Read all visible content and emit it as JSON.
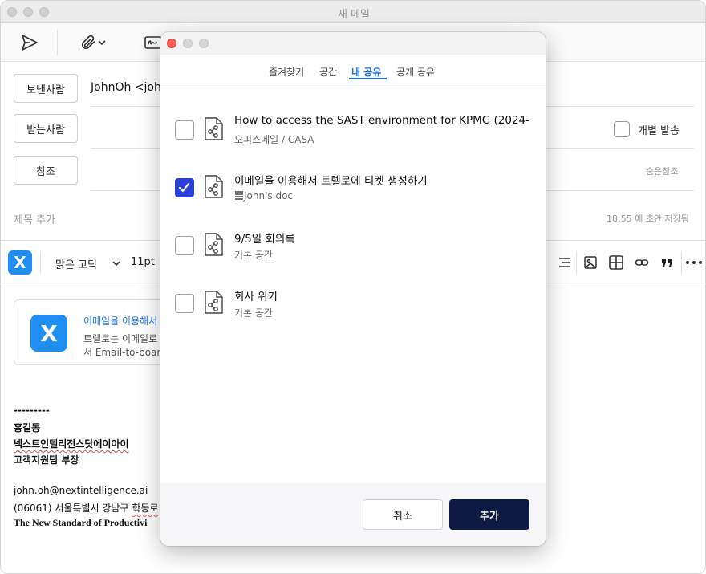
{
  "window": {
    "title": "새 메일"
  },
  "compose": {
    "from_label": "보낸사람",
    "from_value": "JohnOh <john",
    "to_label": "받는사람",
    "cc_label": "참조",
    "individual_send": "개별 발송",
    "bcc_link": "숨은참조",
    "subject_placeholder": "제목 추가",
    "saved_status": "18:55 에 초안 저장됨"
  },
  "format_toolbar": {
    "font": "맑은 고딕",
    "size": "11pt"
  },
  "card": {
    "title": "이메일을 이용해서",
    "desc_line1": "트렐로는 이메일로",
    "desc_line2": "서 Email-to-board"
  },
  "signature": {
    "dashes": "---------",
    "name": "홍길동",
    "company": "넥스트인텔리전스닷에이아이",
    "position": "고객지원팀 부장",
    "email": "john.oh@nextintelligence.ai",
    "address_prefix": "(06061) 서울특별시 강남구 ",
    "address_tail": "학동로",
    "tagline": "The New Standard of Productivi"
  },
  "dialog": {
    "tabs": [
      {
        "label": "즐겨찾기"
      },
      {
        "label": "공간"
      },
      {
        "label": "내 공유"
      },
      {
        "label": "공개 공유"
      }
    ],
    "active_tab": "내 공유",
    "items": [
      {
        "title": "How to access the SAST environment for KPMG (2024-",
        "subtitle": "오피스메일 / CASA",
        "checked": false
      },
      {
        "title": "이메일을 이용해서 트렐로에 티켓 생성하기",
        "subtitle": "John's doc",
        "checked": true
      },
      {
        "title": "9/5일 회의록",
        "subtitle": "기본 공간",
        "checked": false
      },
      {
        "title": "회사 위키",
        "subtitle": "기본 공간",
        "checked": false
      }
    ],
    "cancel_label": "취소",
    "add_label": "추가"
  },
  "colors": {
    "accent": "#1a6fe0",
    "primary_button": "#0f1a44",
    "checkbox_checked": "#2b3fd9",
    "brand_logo": "#1e8ff1"
  }
}
